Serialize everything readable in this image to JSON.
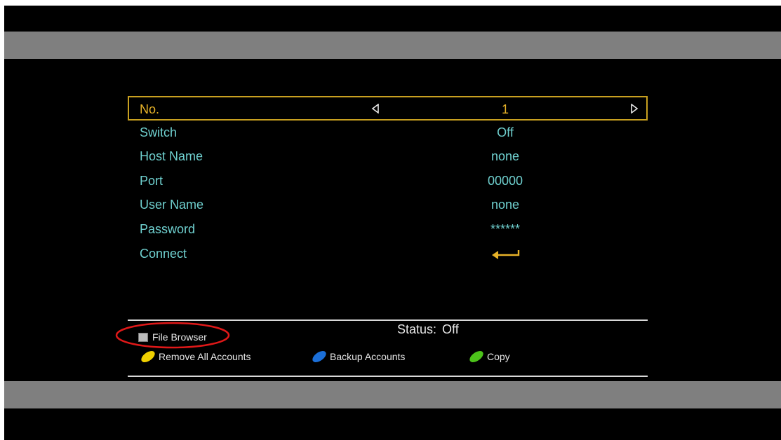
{
  "menu": {
    "rows": [
      {
        "label": "No.",
        "value": "1"
      },
      {
        "label": "Switch",
        "value": "Off"
      },
      {
        "label": "Host Name",
        "value": "none"
      },
      {
        "label": "Port",
        "value": "00000"
      },
      {
        "label": "User Name",
        "value": "none"
      },
      {
        "label": "Password",
        "value": "******"
      },
      {
        "label": "Connect",
        "value_icon": "enter-arrow-icon"
      }
    ]
  },
  "status": {
    "label": "Status:",
    "value": "Off"
  },
  "footer": {
    "file_browser": {
      "label": "File Browser",
      "icon": "gray-square-key-icon"
    },
    "keys": [
      {
        "label": "Remove All Accounts",
        "color": "#f0d000",
        "icon": "yellow-key-icon"
      },
      {
        "label": "Backup Accounts",
        "color": "#1b6fd8",
        "icon": "blue-key-icon"
      },
      {
        "label": "Copy",
        "color": "#4cc21a",
        "icon": "green-key-icon"
      }
    ]
  },
  "colors": {
    "label_text": "#6fd0cf",
    "selected_text": "#e7b228",
    "selection_border": "#c8a020",
    "letterbox_bar": "#7f7f7f",
    "highlight_ellipse": "#e01818"
  }
}
